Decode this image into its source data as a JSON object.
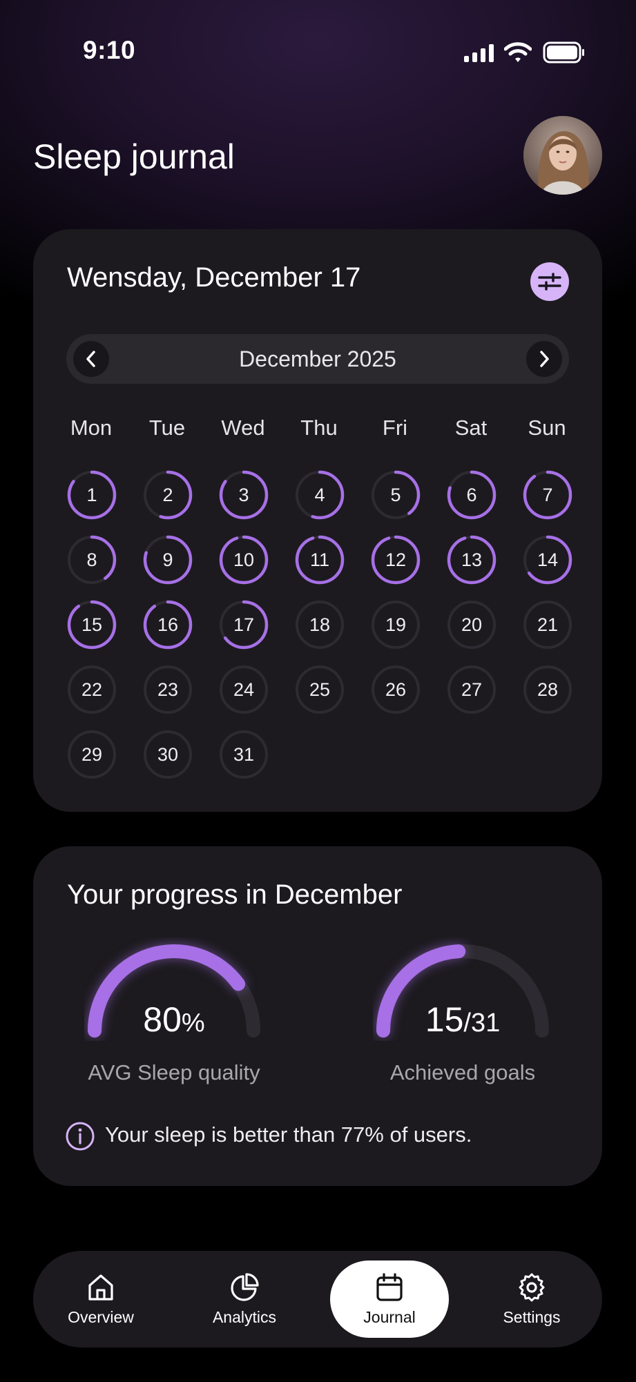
{
  "status_bar": {
    "time": "9:10"
  },
  "header": {
    "title": "Sleep journal"
  },
  "calendar": {
    "selected_date": "Wensday, December 17",
    "month_label": "December 2025",
    "weekdays": [
      "Mon",
      "Tue",
      "Wed",
      "Thu",
      "Fri",
      "Sat",
      "Sun"
    ],
    "days": [
      {
        "n": "1",
        "q": 0.85
      },
      {
        "n": "2",
        "q": 0.55
      },
      {
        "n": "3",
        "q": 0.85
      },
      {
        "n": "4",
        "q": 0.55
      },
      {
        "n": "5",
        "q": 0.4
      },
      {
        "n": "6",
        "q": 0.8
      },
      {
        "n": "7",
        "q": 0.9
      },
      {
        "n": "8",
        "q": 0.4
      },
      {
        "n": "9",
        "q": 0.8
      },
      {
        "n": "10",
        "q": 0.95
      },
      {
        "n": "11",
        "q": 0.95
      },
      {
        "n": "12",
        "q": 0.95
      },
      {
        "n": "13",
        "q": 0.95
      },
      {
        "n": "14",
        "q": 0.65
      },
      {
        "n": "15",
        "q": 0.9
      },
      {
        "n": "16",
        "q": 0.9
      },
      {
        "n": "17",
        "q": 0.65
      },
      {
        "n": "18",
        "q": 0
      },
      {
        "n": "19",
        "q": 0
      },
      {
        "n": "20",
        "q": 0
      },
      {
        "n": "21",
        "q": 0
      },
      {
        "n": "22",
        "q": 0
      },
      {
        "n": "23",
        "q": 0
      },
      {
        "n": "24",
        "q": 0
      },
      {
        "n": "25",
        "q": 0
      },
      {
        "n": "26",
        "q": 0
      },
      {
        "n": "27",
        "q": 0
      },
      {
        "n": "28",
        "q": 0
      },
      {
        "n": "29",
        "q": 0
      },
      {
        "n": "30",
        "q": 0
      },
      {
        "n": "31",
        "q": 0
      }
    ]
  },
  "progress": {
    "title": "Your progress in December",
    "sleep_quality": {
      "value": "80",
      "unit": "%",
      "label": "AVG Sleep quality",
      "fraction": 0.8
    },
    "goals": {
      "value": "15",
      "total": "/31",
      "label": "Achieved goals",
      "fraction": 0.484
    },
    "info_text": "Your sleep is better than 77% of users."
  },
  "nav": {
    "items": [
      {
        "label": "Overview",
        "icon": "home-icon"
      },
      {
        "label": "Analytics",
        "icon": "pie-chart-icon"
      },
      {
        "label": "Journal",
        "icon": "calendar-icon",
        "active": true
      },
      {
        "label": "Settings",
        "icon": "gear-icon"
      }
    ]
  },
  "colors": {
    "accent": "#a770e6",
    "track": "#2d2b31",
    "card": "#1c1a1f",
    "filter_button": "#d6b4f7"
  }
}
